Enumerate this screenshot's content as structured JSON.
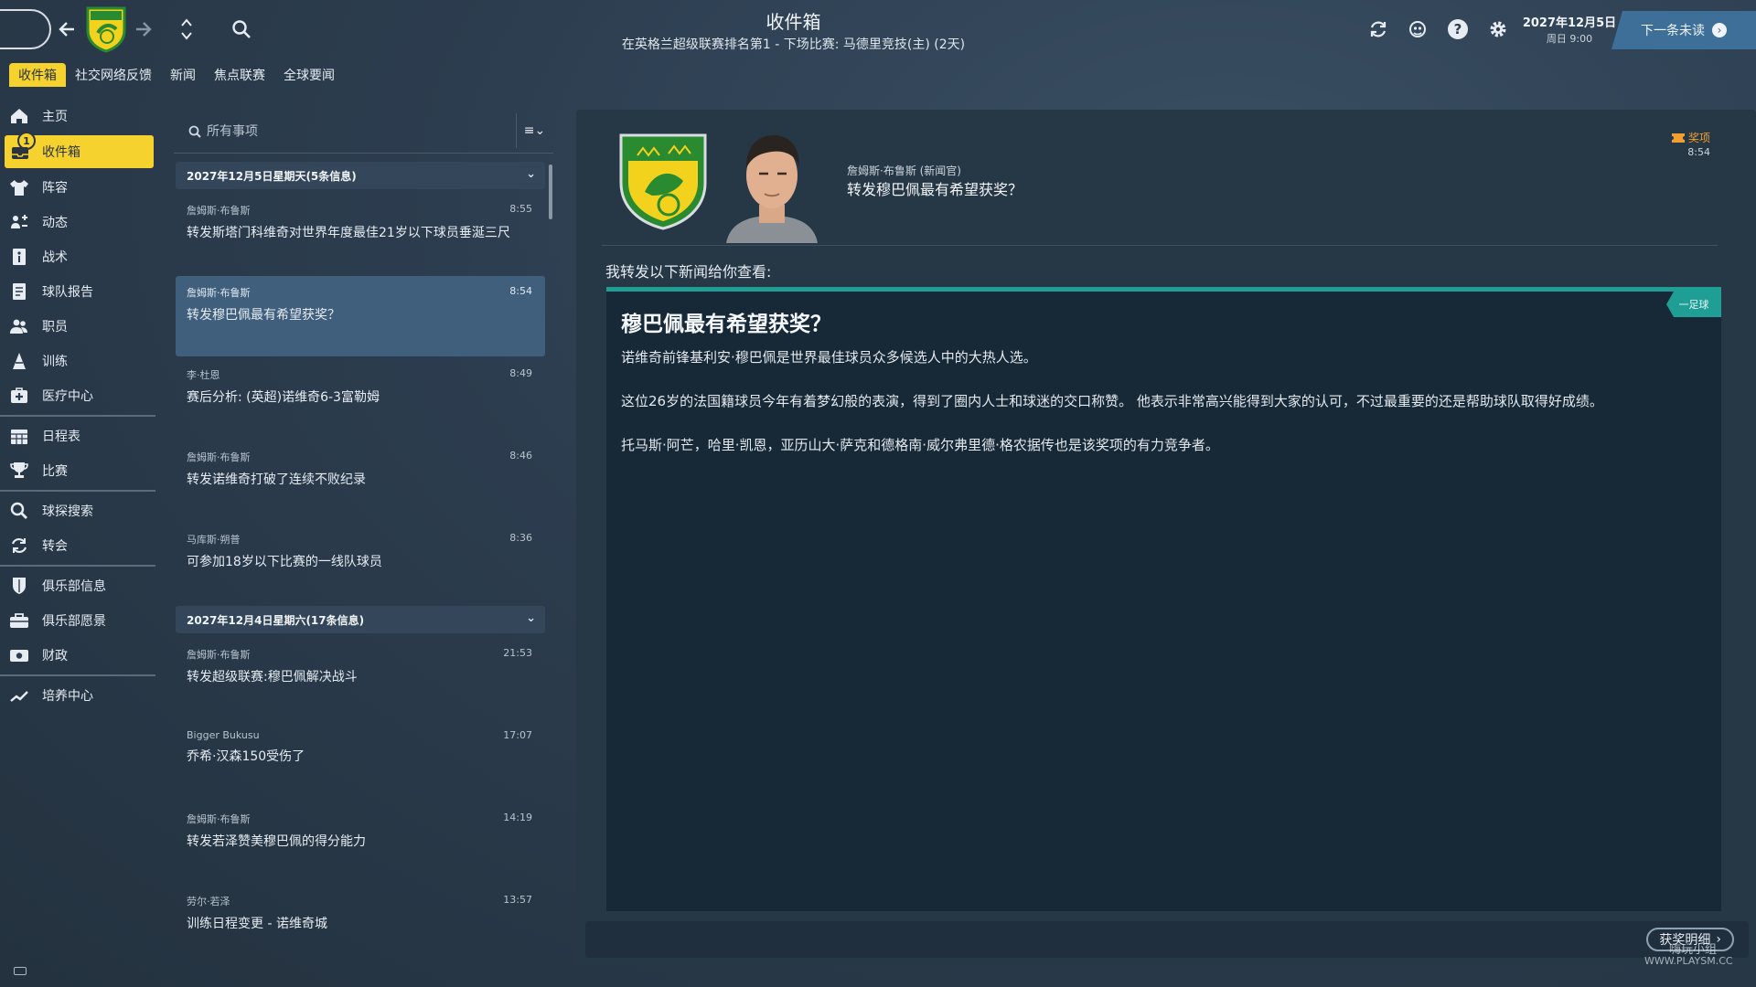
{
  "header": {
    "title": "收件箱",
    "subtitle": "在英格兰超级联赛排名第1 - 下场比赛: 马德里竞技(主) (2天)",
    "date": "2027年12月5日",
    "day_time": "周日 9:00",
    "next_unread": "下一条未读"
  },
  "subtabs": [
    "收件箱",
    "社交网络反馈",
    "新闻",
    "焦点联赛",
    "全球要闻"
  ],
  "sidebar": {
    "inbox_badge": "1",
    "items": [
      {
        "label": "主页",
        "icon": "home-icon"
      },
      {
        "label": "收件箱",
        "icon": "inbox-icon"
      },
      {
        "label": "阵容",
        "icon": "shirt-icon"
      },
      {
        "label": "动态",
        "icon": "dynamics-icon"
      },
      {
        "label": "战术",
        "icon": "tactics-icon"
      },
      {
        "label": "球队报告",
        "icon": "report-icon"
      },
      {
        "label": "职员",
        "icon": "staff-icon"
      },
      {
        "label": "训练",
        "icon": "training-icon"
      },
      {
        "label": "医疗中心",
        "icon": "medical-icon"
      },
      {
        "label": "日程表",
        "icon": "calendar-icon"
      },
      {
        "label": "比赛",
        "icon": "trophy-icon"
      },
      {
        "label": "球探搜索",
        "icon": "scouting-icon"
      },
      {
        "label": "转会",
        "icon": "transfer-icon"
      },
      {
        "label": "俱乐部信息",
        "icon": "club-shield-icon"
      },
      {
        "label": "俱乐部愿景",
        "icon": "vision-icon"
      },
      {
        "label": "财政",
        "icon": "finance-icon"
      },
      {
        "label": "培养中心",
        "icon": "development-icon"
      }
    ]
  },
  "list": {
    "search_placeholder": "所有事项",
    "days": [
      {
        "header": "2027年12月5日星期天(5条信息)",
        "messages": [
          {
            "sender": "詹姆斯·布鲁斯",
            "time": "8:55",
            "subject": "转发斯塔门科维奇对世界年度最佳21岁以下球员垂涎三尺"
          },
          {
            "sender": "詹姆斯·布鲁斯",
            "time": "8:54",
            "subject": "转发穆巴佩最有希望获奖？"
          },
          {
            "sender": "李·杜恩",
            "time": "8:49",
            "subject": "赛后分析: (英超)诺维奇6-3富勒姆"
          },
          {
            "sender": "詹姆斯·布鲁斯",
            "time": "8:46",
            "subject": "转发诺维奇打破了连续不败纪录"
          },
          {
            "sender": "马库斯·朔普",
            "time": "8:36",
            "subject": "可参加18岁以下比赛的一线队球员"
          }
        ]
      },
      {
        "header": "2027年12月4日星期六(17条信息)",
        "messages": [
          {
            "sender": "詹姆斯·布鲁斯",
            "time": "21:53",
            "subject": "转发超级联赛:穆巴佩解决战斗"
          },
          {
            "sender": "Bigger Bukusu",
            "time": "17:07",
            "subject": "乔希·汉森150受伤了"
          },
          {
            "sender": "詹姆斯·布鲁斯",
            "time": "14:19",
            "subject": "转发若泽赞美穆巴佩的得分能力"
          },
          {
            "sender": "劳尔·若泽",
            "time": "13:57",
            "subject": "训练日程变更 - 诺维奇城"
          }
        ]
      }
    ]
  },
  "reader": {
    "tag": "奖项",
    "time": "8:54",
    "from": "詹姆斯·布鲁斯 (新闻官)",
    "subject": "转发穆巴佩最有希望获奖？",
    "intro": "我转发以下新闻给你查看:",
    "source_tag": "一足球",
    "article_title": "穆巴佩最有希望获奖？",
    "paragraphs": [
      "诺维奇前锋基利安·穆巴佩是世界最佳球员众多候选人中的大热人选。",
      "这位26岁的法国籍球员今年有着梦幻般的表演，得到了圈内人士和球迷的交口称赞。 他表示非常高兴能得到大家的认可，不过最重要的还是帮助球队取得好成绩。",
      "托马斯·阿芒，哈里·凯恩，亚历山大·萨克和德格南·威尔弗里德·格农据传也是该奖项的有力竞争者。"
    ],
    "award_details_button": "获奖明细"
  },
  "watermark": {
    "text1": "嗨玩小组",
    "text2": "WWW.PLAYSM.CC"
  },
  "colors": {
    "accent_yellow": "#f5d22e",
    "selected_blue": "#3f5f7c",
    "teal": "#1f9e96",
    "award_orange": "#f0a030"
  }
}
